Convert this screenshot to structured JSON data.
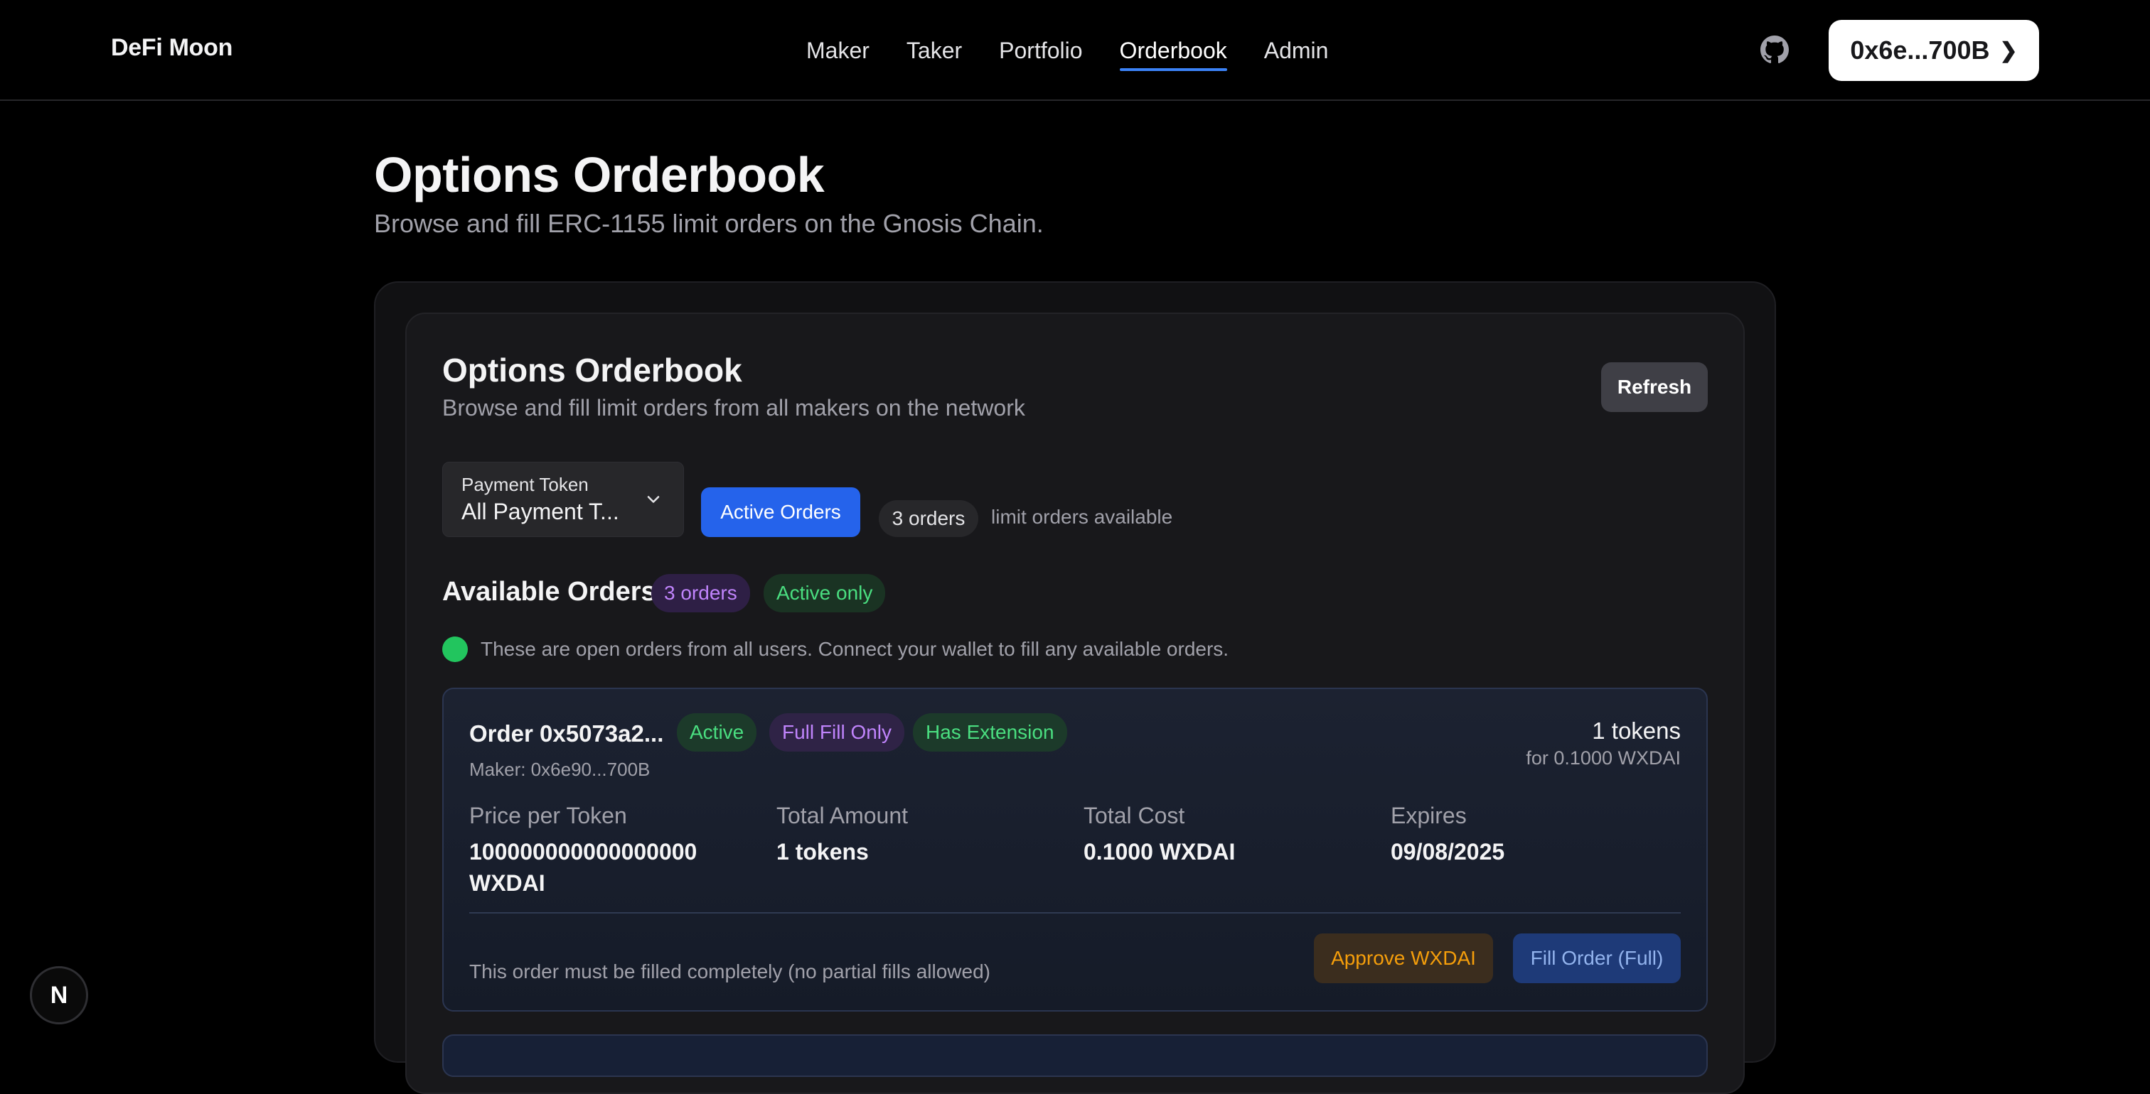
{
  "header": {
    "brand": "DeFi Moon",
    "nav": [
      "Maker",
      "Taker",
      "Portfolio",
      "Orderbook",
      "Admin"
    ],
    "active_nav": "Orderbook",
    "wallet_label": "0x6e...700B",
    "github_icon": "github-icon"
  },
  "page": {
    "title": "Options Orderbook",
    "subtitle": "Browse and fill ERC-1155 limit orders on the Gnosis Chain."
  },
  "card": {
    "title": "Options Orderbook",
    "subtitle": "Browse and fill limit orders from all makers on the network",
    "refresh_label": "Refresh"
  },
  "filters": {
    "payment_token_label": "Payment Token",
    "payment_token_value": "All Payment T...",
    "active_orders_label": "Active Orders",
    "orders_count": "3 orders",
    "orders_available_text": "limit orders available"
  },
  "available": {
    "title": "Available Orders",
    "count_badge": "3 orders",
    "filter_badge": "Active only",
    "info_text": "These are open orders from all users. Connect your wallet to fill any available orders."
  },
  "orders": [
    {
      "title": "Order 0x5073a2...",
      "badges": [
        "Active",
        "Full Fill Only",
        "Has Extension"
      ],
      "maker": "Maker: 0x6e90...700B",
      "amount_summary": "1 tokens",
      "cost_summary": "for 0.1000 WXDAI",
      "fields": [
        {
          "label": "Price per Token",
          "value": "100000000000000000 WXDAI"
        },
        {
          "label": "Total Amount",
          "value": "1 tokens"
        },
        {
          "label": "Total Cost",
          "value": "0.1000 WXDAI"
        },
        {
          "label": "Expires",
          "value": "09/08/2025"
        }
      ],
      "note": "This order must be filled completely (no partial fills allowed)",
      "approve_label": "Approve WXDAI",
      "fill_label": "Fill Order (Full)"
    }
  ],
  "nextjs_badge": "N",
  "colors": {
    "accent_blue": "#2563eb",
    "nav_underline": "#3b82f6",
    "green": "#4ade80",
    "purple": "#c084fc",
    "amber": "#f59e0b"
  }
}
